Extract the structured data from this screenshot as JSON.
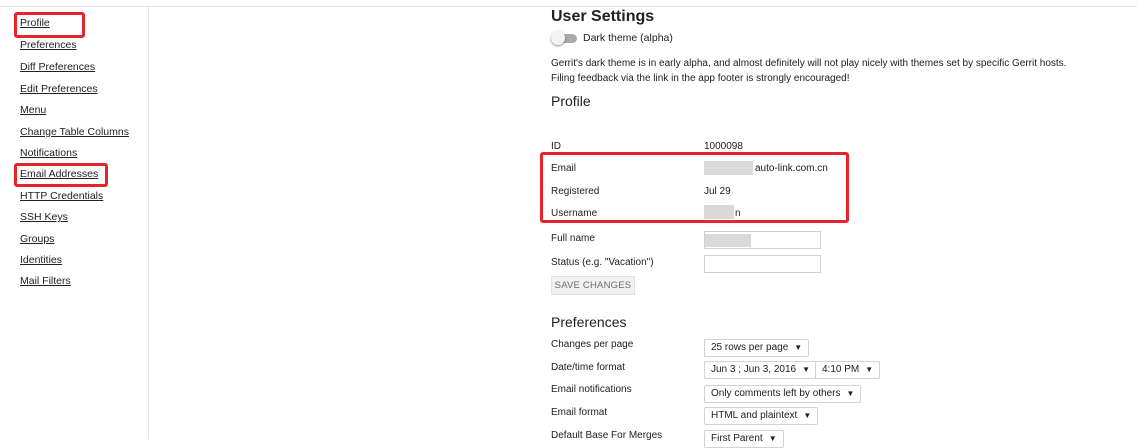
{
  "sidebar": {
    "items": [
      {
        "label": "Profile"
      },
      {
        "label": "Preferences"
      },
      {
        "label": "Diff Preferences"
      },
      {
        "label": "Edit Preferences"
      },
      {
        "label": "Menu"
      },
      {
        "label": "Change Table Columns"
      },
      {
        "label": "Notifications"
      },
      {
        "label": "Email Addresses"
      },
      {
        "label": "HTTP Credentials"
      },
      {
        "label": "SSH Keys"
      },
      {
        "label": "Groups"
      },
      {
        "label": "Identities"
      },
      {
        "label": "Mail Filters"
      }
    ]
  },
  "page": {
    "title": "User Settings",
    "dark_theme_label": "Dark theme (alpha)",
    "dark_theme_note": "Gerrit's dark theme is in early alpha, and almost definitely will not play nicely with themes set by specific Gerrit hosts. Filing feedback via the link in the app footer is strongly encouraged!"
  },
  "profile": {
    "heading": "Profile",
    "id_label": "ID",
    "id_value": "1000098",
    "email_label": "Email",
    "email_value": "auto-link.com.cn",
    "registered_label": "Registered",
    "registered_value": "Jul 29",
    "username_label": "Username",
    "username_value": "n",
    "fullname_label": "Full name",
    "status_label": "Status (e.g. \"Vacation\")",
    "save_label": "SAVE CHANGES"
  },
  "preferences": {
    "heading": "Preferences",
    "changes_per_page_label": "Changes per page",
    "changes_per_page_value": "25 rows per page",
    "datetime_label": "Date/time format",
    "date_value": "Jun 3 ; Jun 3, 2016",
    "time_value": "4:10 PM",
    "email_notifications_label": "Email notifications",
    "email_notifications_value": "Only comments left by others",
    "email_format_label": "Email format",
    "email_format_value": "HTML and plaintext",
    "default_base_label": "Default Base For Merges",
    "default_base_value": "First Parent"
  },
  "colors": {
    "highlight": "#e8232b",
    "toggle_track": "#aaaaaa"
  }
}
